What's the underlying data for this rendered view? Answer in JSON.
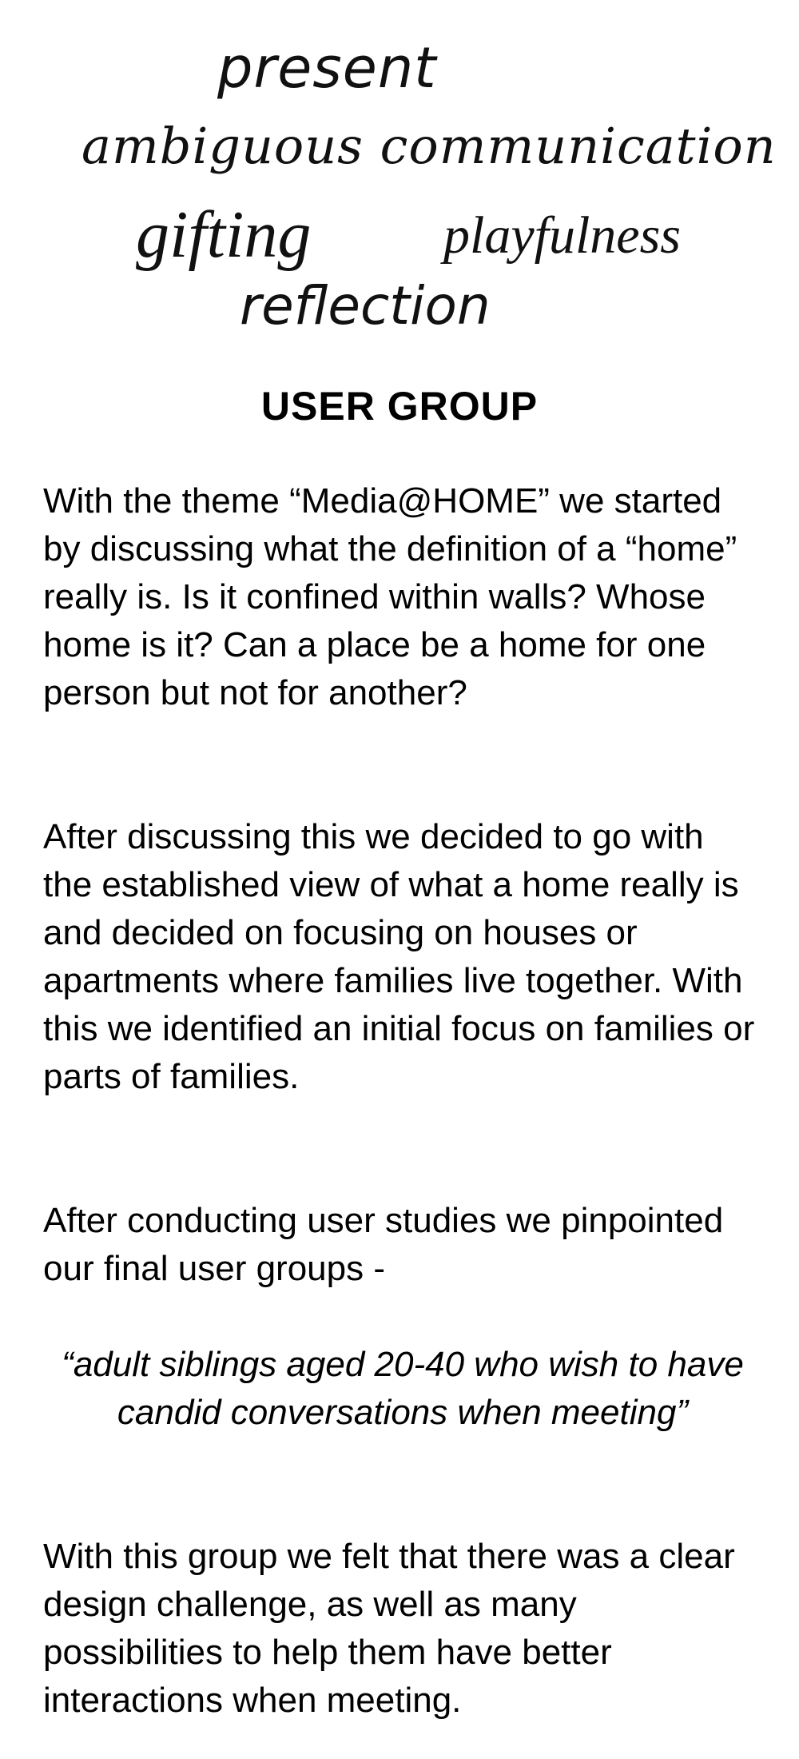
{
  "word_cloud": {
    "present": "present",
    "ambiguous_communication": "ambiguous communication",
    "gifting": "gifting",
    "playfulness": "playfulness",
    "reflection": "reflection"
  },
  "heading": "USER GROUP",
  "paragraphs": [
    "With the theme “Media@HOME” we started by discussing what the definition of a “home” really is. Is it confined within walls? Whose home is it? Can a place be a home for one person but not for another?",
    "After discussing this we decided to go with the established view of what a home really is and decided on focusing on houses or apartments where families live together. With this we identified an initial focus on families or parts of families.",
    "After conducting user studies we pinpointed our final user groups -",
    "With this group we felt that there was a clear design challenge, as well as many possibilities to help them have better interactions when meeting."
  ],
  "quote": "“adult siblings aged 20-40 who wish to have candid conversations when meeting”"
}
